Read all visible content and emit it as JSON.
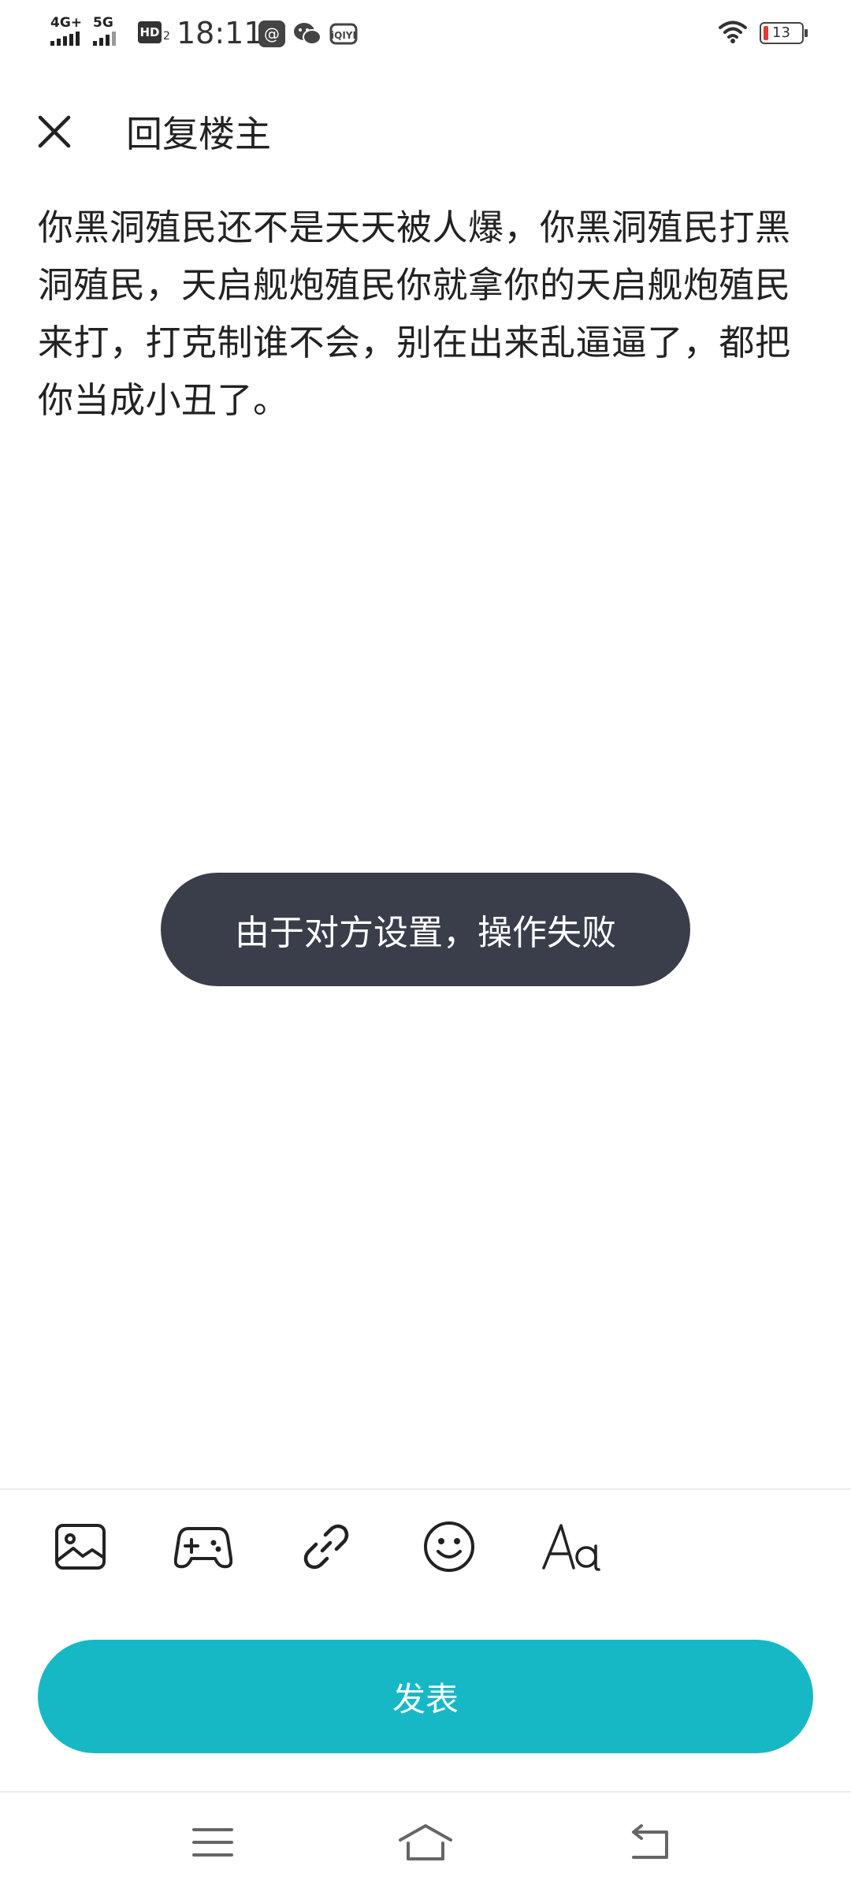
{
  "status_bar": {
    "network_1": "4G+",
    "network_2": "5G",
    "hd_label": "HD",
    "hd_sub": "2",
    "time": "18:11",
    "app_icons": [
      "at-sign-app-icon",
      "wechat-icon",
      "iqiyi-icon"
    ],
    "battery_percent": "13",
    "battery_level": 0.13,
    "battery_low_color": "#e53935"
  },
  "header": {
    "close_icon": "close-icon",
    "title": "回复楼主"
  },
  "reply": {
    "text": "你黑洞殖民还不是天天被人爆，你黑洞殖民打黑洞殖民，天启舰炮殖民你就拿你的天启舰炮殖民来打，打克制谁不会，别在出来乱逼逼了，都把你当成小丑了。"
  },
  "toast": {
    "message": "由于对方设置，操作失败",
    "background": "#3a3e4b"
  },
  "toolbar": {
    "items": [
      "image-icon",
      "gamepad-icon",
      "link-icon",
      "emoji-icon",
      "font-style-icon"
    ]
  },
  "publish": {
    "label": "发表",
    "color": "#17b8c6"
  },
  "nav_bar": {
    "items": [
      "menu-icon",
      "home-icon",
      "back-icon"
    ]
  }
}
